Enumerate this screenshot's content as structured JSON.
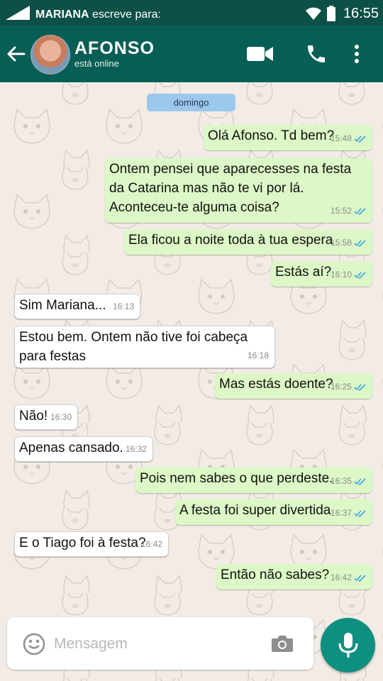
{
  "status_bar": {
    "sender_name": "MARIANA",
    "sender_action": "escreve para:",
    "time": "16:55",
    "icons": [
      "signal-icon",
      "wifi-icon",
      "battery-icon"
    ]
  },
  "header": {
    "contact_name": "AFONSO",
    "contact_status": "está online",
    "icons": [
      "back-arrow-icon",
      "video-call-icon",
      "phone-icon",
      "more-vert-icon"
    ]
  },
  "chat": {
    "date_label": "domingo",
    "messages": [
      {
        "dir": "out",
        "text": "Olá Afonso. Td bem?",
        "time": "15:48",
        "read": true
      },
      {
        "dir": "out",
        "text": "Ontem pensei que aparecesses na festa da Catarina mas não te vi por lá. Aconteceu-te alguma coisa?",
        "time": "15:52",
        "read": true
      },
      {
        "dir": "out",
        "text": "Ela ficou a noite toda à tua espera",
        "time": "15:58",
        "read": true
      },
      {
        "dir": "out",
        "text": "Estás aí?",
        "time": "16:10",
        "read": true
      },
      {
        "dir": "in",
        "text": "Sim Mariana...",
        "time": "16:13"
      },
      {
        "dir": "in",
        "text": "Estou bem. Ontem não tive foi cabeça para festas",
        "time": "16:18"
      },
      {
        "dir": "out",
        "text": "Mas estás doente?",
        "time": "16:25",
        "read": true
      },
      {
        "dir": "in",
        "text": "Não!",
        "time": "16:30"
      },
      {
        "dir": "in",
        "text": "Apenas cansado.",
        "time": "16:32"
      },
      {
        "dir": "out",
        "text": "Pois nem sabes o que perdeste.",
        "time": "16:35",
        "read": true
      },
      {
        "dir": "out",
        "text": "A festa foi super divertida",
        "time": "16:37",
        "read": true
      },
      {
        "dir": "in",
        "text": "E o Tiago foi à festa?",
        "time": "16:42"
      },
      {
        "dir": "out",
        "text": "Então não sabes?",
        "time": "16:42",
        "read": true
      }
    ]
  },
  "composer": {
    "placeholder": "Mensagem",
    "icons": [
      "emoji-icon",
      "camera-icon",
      "mic-icon"
    ]
  },
  "colors": {
    "header": "#075e54",
    "status_bar": "#0c5047",
    "outgoing_bubble": "#dcf8c6",
    "incoming_bubble": "#ffffff",
    "read_ticks": "#34a3e6",
    "mic_button": "#0f8f7f",
    "date_chip": "#9cc8ee"
  }
}
